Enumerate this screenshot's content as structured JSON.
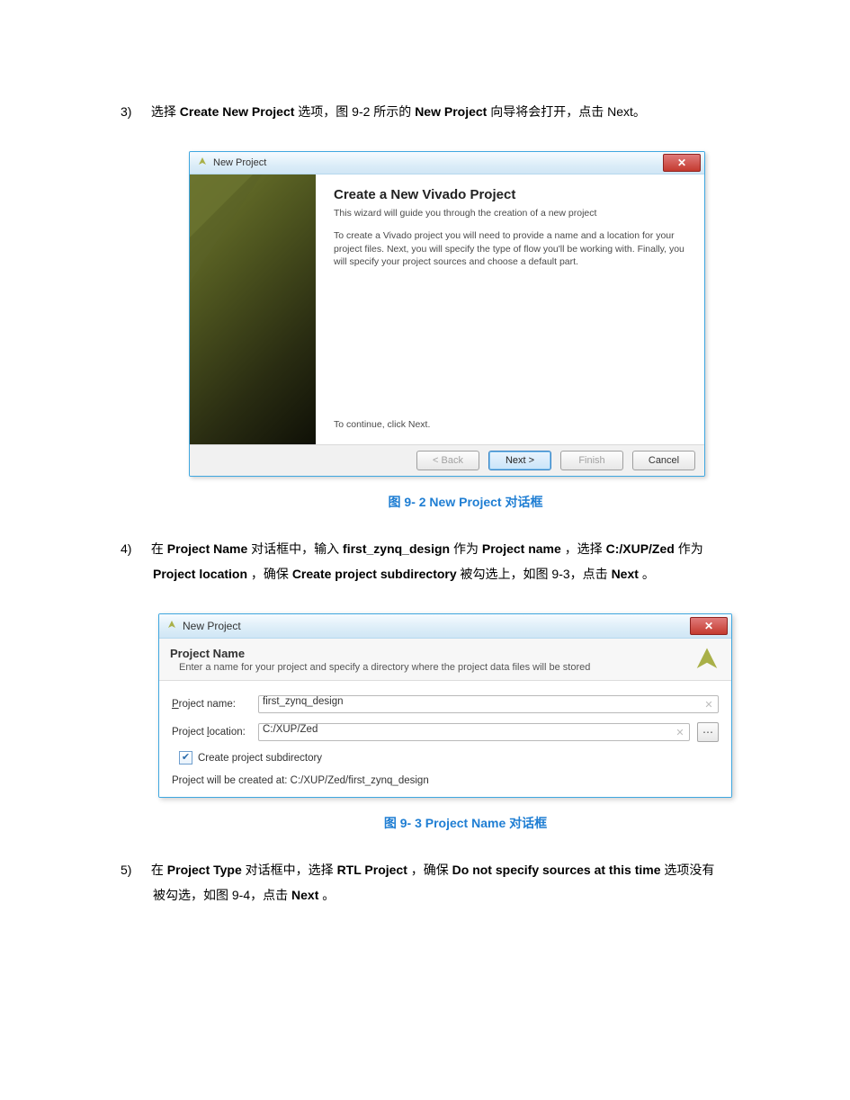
{
  "step3": {
    "num": "3)",
    "t1": "选择 ",
    "b1": "Create New Project",
    "t2": " 选项，图 9-2 所示的 ",
    "b2": "New Project",
    "t3": " 向导将会打开，点击 Next。"
  },
  "dlg1": {
    "window_title": "New Project",
    "heading": "Create a New Vivado Project",
    "subheading": "This wizard will guide you through the creation of a new project",
    "desc": "To create a Vivado project you will need to provide a name and a location for your project files. Next, you will specify the type of flow you'll be working with. Finally, you will specify your project sources and choose a default part.",
    "continue": "To continue, click Next.",
    "btn_back": "< Back",
    "btn_next": "Next >",
    "btn_finish": "Finish",
    "btn_cancel": "Cancel"
  },
  "caption1": "图 9- 2 New Project 对话框",
  "step4": {
    "num": "4)",
    "t1": "在 ",
    "b1": "Project Name",
    "t2": " 对话框中，输入 ",
    "b2": "first_zynq_design",
    "t3": " 作为 ",
    "b3": "Project name",
    "t4": "，选择 ",
    "b4": "C:/XUP/Zed",
    "t5": " 作为",
    "line2_b1": "Project location",
    "line2_t1": "，确保 ",
    "line2_b2": "Create project subdirectory",
    "line2_t2": " 被勾选上，如图 9-3，点击 ",
    "line2_b3": "Next",
    "line2_t3": "。"
  },
  "dlg2": {
    "window_title": "New Project",
    "header_title": "Project Name",
    "header_sub": "Enter a name for your project and specify a directory where the project data files will be stored",
    "label_name_pre": "P",
    "label_name_rest": "roject name:",
    "value_name": "first_zynq_design",
    "label_loc_pre": "Project ",
    "label_loc_u": "l",
    "label_loc_rest": "ocation:",
    "value_loc": "C:/XUP/Zed",
    "check_label": "Create project subdirectory",
    "created_at_prefix": "Project will be created at: ",
    "created_at_path": "C:/XUP/Zed/first_zynq_design"
  },
  "caption2": "图 9- 3 Project Name 对话框",
  "step5": {
    "num": "5)",
    "t1": "在 ",
    "b1": "Project Type",
    "t2": " 对话框中，选择 ",
    "b2": "RTL Project",
    "t3": "，确保 ",
    "b3": "Do not specify sources at this time",
    "t4": " 选项没有",
    "line2_t1": "被勾选，如图 9-4，点击 ",
    "line2_b1": "Next",
    "line2_t2": "。"
  }
}
